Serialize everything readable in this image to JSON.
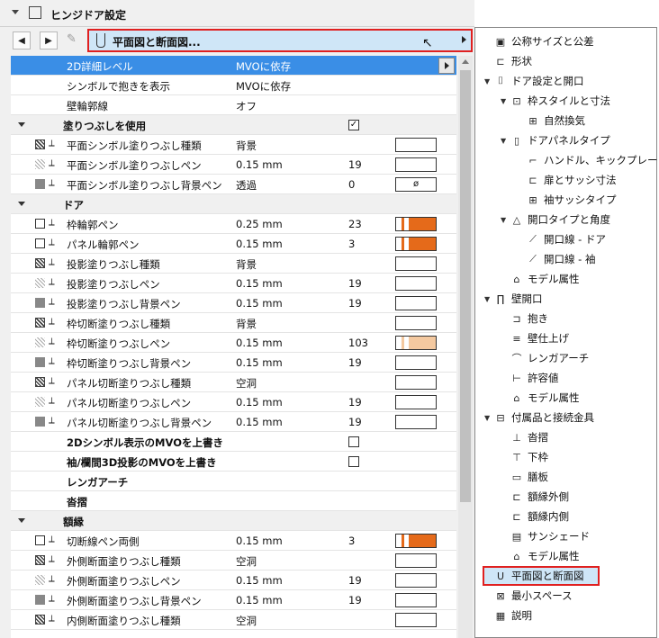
{
  "panel": {
    "title": "ヒンジドア設定",
    "path": "平面図と断面図...",
    "editicon": "✎"
  },
  "rows": [
    {
      "kind": "sel",
      "label": "2D詳細レベル",
      "value": "MVOに依存",
      "btn": true
    },
    {
      "kind": "prop",
      "label": "シンボルで抱きを表示",
      "value": "MVOに依存"
    },
    {
      "kind": "prop",
      "label": "壁輪郭線",
      "value": "オフ"
    },
    {
      "kind": "sec",
      "label": "塗りつぶしを使用",
      "check": "✓"
    },
    {
      "kind": "prop",
      "ic": "hatch",
      "pen": true,
      "label": "平面シンボル塗りつぶし種類",
      "value": "背景",
      "sw": ""
    },
    {
      "kind": "prop",
      "ic": "light",
      "pen": true,
      "label": "平面シンボル塗りつぶしペン",
      "value": "0.15 mm",
      "num": "19",
      "sw": ""
    },
    {
      "kind": "prop",
      "ic": "solid",
      "pen": true,
      "label": "平面シンボル塗りつぶし背景ペン",
      "value": "透過",
      "num": "0",
      "sw": "ø"
    },
    {
      "kind": "sec",
      "label": "ドア"
    },
    {
      "kind": "prop",
      "ic": "box",
      "pen": true,
      "label": "枠輪郭ペン",
      "value": "0.25 mm",
      "num": "23",
      "sw": "orange"
    },
    {
      "kind": "prop",
      "ic": "box",
      "pen": true,
      "label": "パネル輪郭ペン",
      "value": "0.15 mm",
      "num": "3",
      "sw": "orange"
    },
    {
      "kind": "prop",
      "ic": "hatch",
      "pen": true,
      "label": "投影塗りつぶし種類",
      "value": "背景",
      "sw": ""
    },
    {
      "kind": "prop",
      "ic": "light",
      "pen": true,
      "label": "投影塗りつぶしペン",
      "value": "0.15 mm",
      "num": "19",
      "sw": ""
    },
    {
      "kind": "prop",
      "ic": "solid",
      "pen": true,
      "label": "投影塗りつぶし背景ペン",
      "value": "0.15 mm",
      "num": "19",
      "sw": ""
    },
    {
      "kind": "prop",
      "ic": "hatch",
      "pen": true,
      "label": "枠切断塗りつぶし種類",
      "value": "背景",
      "sw": ""
    },
    {
      "kind": "prop",
      "ic": "light",
      "pen": true,
      "label": "枠切断塗りつぶしペン",
      "value": "0.15 mm",
      "num": "103",
      "sw": "peach"
    },
    {
      "kind": "prop",
      "ic": "solid",
      "pen": true,
      "label": "枠切断塗りつぶし背景ペン",
      "value": "0.15 mm",
      "num": "19",
      "sw": ""
    },
    {
      "kind": "prop",
      "ic": "hatch",
      "pen": true,
      "label": "パネル切断塗りつぶし種類",
      "value": "空洞",
      "sw": ""
    },
    {
      "kind": "prop",
      "ic": "light",
      "pen": true,
      "label": "パネル切断塗りつぶしペン",
      "value": "0.15 mm",
      "num": "19",
      "sw": ""
    },
    {
      "kind": "prop",
      "ic": "solid",
      "pen": true,
      "label": "パネル切断塗りつぶし背景ペン",
      "value": "0.15 mm",
      "num": "19",
      "sw": ""
    },
    {
      "kind": "bold",
      "label": "2Dシンボル表示のMVOを上書き",
      "check": ""
    },
    {
      "kind": "bold",
      "label": "袖/欄間3D投影のMVOを上書き",
      "check": ""
    },
    {
      "kind": "bold",
      "label": "レンガアーチ"
    },
    {
      "kind": "bold",
      "label": "沓摺"
    },
    {
      "kind": "sec",
      "label": "額縁"
    },
    {
      "kind": "prop",
      "ic": "box",
      "pen": true,
      "label": "切断線ペン両側",
      "value": "0.15 mm",
      "num": "3",
      "sw": "orange"
    },
    {
      "kind": "prop",
      "ic": "hatch",
      "pen": true,
      "label": "外側断面塗りつぶし種類",
      "value": "空洞",
      "sw": ""
    },
    {
      "kind": "prop",
      "ic": "light",
      "pen": true,
      "label": "外側断面塗りつぶしペン",
      "value": "0.15 mm",
      "num": "19",
      "sw": ""
    },
    {
      "kind": "prop",
      "ic": "solid",
      "pen": true,
      "label": "外側断面塗りつぶし背景ペン",
      "value": "0.15 mm",
      "num": "19",
      "sw": ""
    },
    {
      "kind": "prop",
      "ic": "hatch",
      "pen": true,
      "label": "内側断面塗りつぶし種類",
      "value": "空洞",
      "sw": ""
    }
  ],
  "tree": [
    {
      "level": 0,
      "exp": "",
      "icon": "▣",
      "label": "公称サイズと公差"
    },
    {
      "level": 0,
      "exp": "",
      "icon": "⊏",
      "label": "形状"
    },
    {
      "level": 0,
      "exp": "▼",
      "icon": "⌷",
      "label": "ドア設定と開口"
    },
    {
      "level": 1,
      "exp": "▼",
      "icon": "⊡",
      "label": "枠スタイルと寸法"
    },
    {
      "level": 2,
      "exp": "",
      "icon": "⊞",
      "label": "自然換気"
    },
    {
      "level": 1,
      "exp": "▼",
      "icon": "▯",
      "label": "ドアパネルタイプ"
    },
    {
      "level": 2,
      "exp": "",
      "icon": "⌐",
      "label": "ハンドル、キックプレート"
    },
    {
      "level": 2,
      "exp": "",
      "icon": "⊏",
      "label": "扉とサッシ寸法"
    },
    {
      "level": 2,
      "exp": "",
      "icon": "⊞",
      "label": "袖サッシタイプ"
    },
    {
      "level": 1,
      "exp": "▼",
      "icon": "△",
      "label": "開口タイプと角度"
    },
    {
      "level": 2,
      "exp": "",
      "icon": "⟋",
      "label": "開口線 - ドア"
    },
    {
      "level": 2,
      "exp": "",
      "icon": "⟋",
      "label": "開口線 - 袖"
    },
    {
      "level": 1,
      "exp": "",
      "icon": "⌂",
      "label": "モデル属性"
    },
    {
      "level": 0,
      "exp": "▼",
      "icon": "∏",
      "label": "壁開口"
    },
    {
      "level": 1,
      "exp": "",
      "icon": "⊐",
      "label": "抱き"
    },
    {
      "level": 1,
      "exp": "",
      "icon": "≡",
      "label": "壁仕上げ"
    },
    {
      "level": 1,
      "exp": "",
      "icon": "⌒",
      "label": "レンガアーチ"
    },
    {
      "level": 1,
      "exp": "",
      "icon": "⊢",
      "label": "許容値"
    },
    {
      "level": 1,
      "exp": "",
      "icon": "⌂",
      "label": "モデル属性"
    },
    {
      "level": 0,
      "exp": "▼",
      "icon": "⊟",
      "label": "付属品と接続金具"
    },
    {
      "level": 1,
      "exp": "",
      "icon": "⊥",
      "label": "沓摺"
    },
    {
      "level": 1,
      "exp": "",
      "icon": "⊤",
      "label": "下枠"
    },
    {
      "level": 1,
      "exp": "",
      "icon": "▭",
      "label": "膳板"
    },
    {
      "level": 1,
      "exp": "",
      "icon": "⊏",
      "label": "額縁外側"
    },
    {
      "level": 1,
      "exp": "",
      "icon": "⊏",
      "label": "額縁内側"
    },
    {
      "level": 1,
      "exp": "",
      "icon": "▤",
      "label": "サンシェード"
    },
    {
      "level": 1,
      "exp": "",
      "icon": "⌂",
      "label": "モデル属性"
    },
    {
      "level": 1,
      "exp": "",
      "icon": "U",
      "label": "平面図と断面図",
      "hl": true
    },
    {
      "level": 0,
      "exp": "",
      "icon": "⊠",
      "label": "最小スペース"
    },
    {
      "level": 0,
      "exp": "",
      "icon": "▦",
      "label": "説明"
    }
  ]
}
